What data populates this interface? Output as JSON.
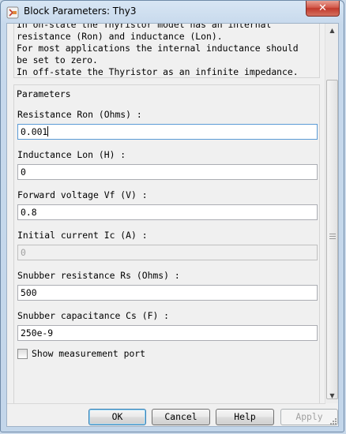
{
  "window": {
    "title": "Block Parameters: Thy3",
    "close_glyph": "✕"
  },
  "description": {
    "lines": [
      "In on-state the Thyristor model has an internal",
      "resistance (Ron) and inductance (Lon).",
      "For most applications the internal inductance should",
      "be set to zero.",
      "In off-state the Thyristor as an infinite impedance."
    ]
  },
  "parameters": {
    "legend": "Parameters",
    "fields": [
      {
        "label": "Resistance Ron (Ohms) :",
        "value": "0.001"
      },
      {
        "label": "Inductance Lon (H) :",
        "value": "0"
      },
      {
        "label": "Forward voltage Vf (V) :",
        "value": "0.8"
      },
      {
        "label": "Initial current Ic (A) :",
        "value": "0"
      },
      {
        "label": "Snubber resistance Rs (Ohms) :",
        "value": "500"
      },
      {
        "label": "Snubber capacitance Cs (F) :",
        "value": "250e-9"
      }
    ],
    "checkbox": {
      "label": "Show measurement port",
      "checked": false
    }
  },
  "buttons": {
    "ok": "OK",
    "cancel": "Cancel",
    "help": "Help",
    "apply": "Apply"
  },
  "icons": {
    "app": "block-parameters-icon",
    "close": "close-icon"
  },
  "colors": {
    "title_bar": "#c7d9ec",
    "close_button": "#c1392b",
    "focus_border": "#5b9bd5"
  }
}
